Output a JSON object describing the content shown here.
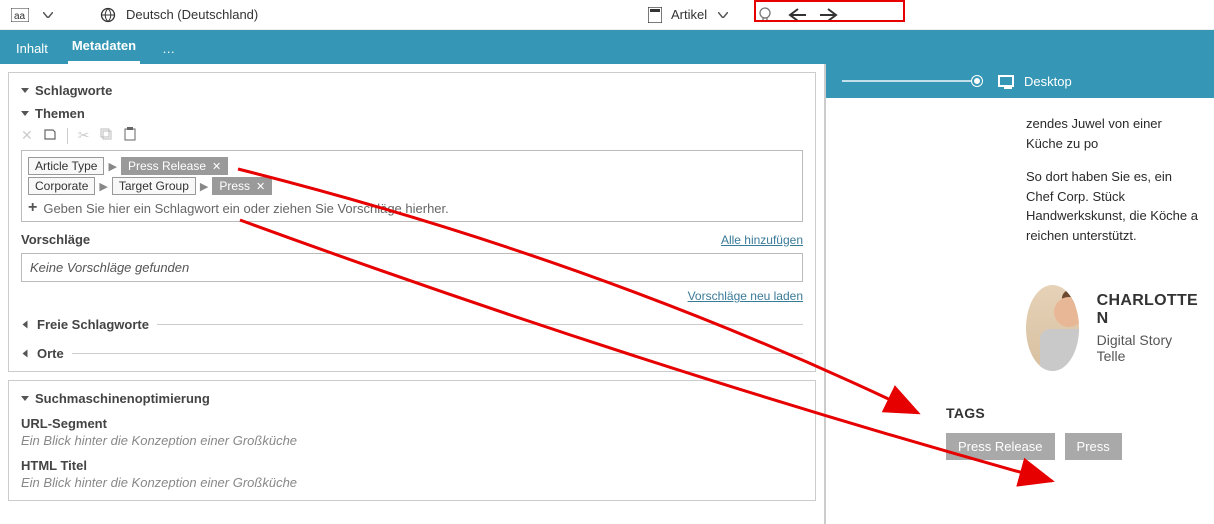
{
  "topbar": {
    "language": "Deutsch (Deutschland)",
    "content_type": "Artikel"
  },
  "tabs": {
    "content": "Inhalt",
    "metadata": "Metadaten",
    "more": "…"
  },
  "schlagworte": {
    "title": "Schlagworte",
    "themen": {
      "title": "Themen",
      "rows": [
        {
          "path": [
            "Article Type"
          ],
          "selected": "Press Release"
        },
        {
          "path": [
            "Corporate",
            "Target Group"
          ],
          "selected": "Press"
        }
      ],
      "input_placeholder": "Geben Sie hier ein Schlagwort ein oder ziehen Sie Vorschläge hierher."
    },
    "vorschlaege": {
      "label": "Vorschläge",
      "add_all": "Alle hinzufügen",
      "empty": "Keine Vorschläge gefunden",
      "reload": "Vorschläge neu laden"
    },
    "freie": "Freie Schlagworte",
    "orte": "Orte"
  },
  "seo": {
    "title": "Suchmaschinenoptimierung",
    "url_label": "URL-Segment",
    "url_value": "Ein Blick hinter die Konzeption einer Großküche",
    "html_title_label": "HTML Titel",
    "html_title_value": "Ein Blick hinter die Konzeption einer Großküche"
  },
  "preview": {
    "device": "Desktop",
    "para1": "zendes Juwel von einer Küche zu po",
    "para2": "So dort haben Sie es, ein Chef Corp. Stück Handwerkskunst, die Köche a reichen unterstützt.",
    "author_name": "CHARLOTTE N",
    "author_role": "Digital Story Telle",
    "tags_title": "TAGS",
    "tags": [
      "Press Release",
      "Press"
    ]
  }
}
